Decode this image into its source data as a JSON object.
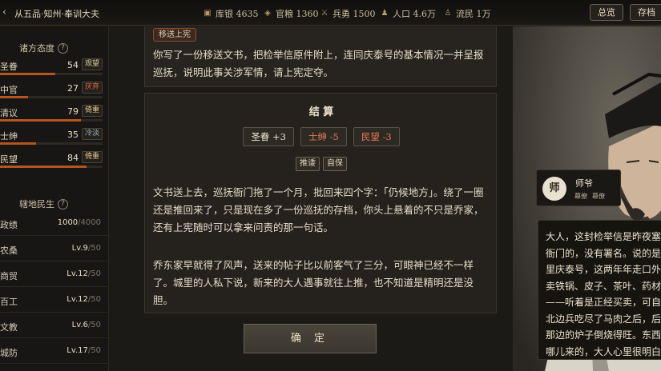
{
  "topbar": {
    "back": "‹",
    "title": "从五品·知州·奉训大夫",
    "resources": [
      {
        "icon": "silver-icon",
        "glyph": "▣",
        "label": "库银 4635"
      },
      {
        "icon": "grain-icon",
        "glyph": "◈",
        "label": "官粮 1360"
      },
      {
        "icon": "soldier-icon",
        "glyph": "⚔",
        "label": "兵勇 1500"
      },
      {
        "icon": "population-icon",
        "glyph": "♟",
        "label": "人口 4.6万"
      },
      {
        "icon": "refugee-icon",
        "glyph": "♙",
        "label": "流民 1万"
      }
    ],
    "overview_btn": "总览",
    "save_btn": "存档"
  },
  "sidebar": {
    "factions_title": "诸方态度",
    "factions": [
      {
        "name": "圣眷",
        "value": "54",
        "tag": "观望",
        "tag_color": "#d6c8a6",
        "level": 54,
        "bar_color": "#b5541f"
      },
      {
        "name": "中官",
        "value": "27",
        "tag": "厌弃",
        "tag_color": "#e0674a",
        "level": 27,
        "bar_color": "#b5541f"
      },
      {
        "name": "清议",
        "value": "79",
        "tag": "倚重",
        "tag_color": "#e6c98a",
        "level": 79,
        "bar_color": "#b5541f"
      },
      {
        "name": "士绅",
        "value": "35",
        "tag": "冷淡",
        "tag_color": "#9fb4c6",
        "level": 35,
        "bar_color": "#b5541f"
      },
      {
        "name": "民望",
        "value": "84",
        "tag": "倚重",
        "tag_color": "#e6c98a",
        "level": 84,
        "bar_color": "#b5541f"
      }
    ],
    "region_title": "辖地民生",
    "stats": [
      {
        "name": "政绩",
        "value": "1000",
        "max": "/4000"
      },
      {
        "name": "农桑",
        "value": "Lv.9",
        "max": "/50"
      },
      {
        "name": "商贸",
        "value": "Lv.12",
        "max": "/50"
      },
      {
        "name": "百工",
        "value": "Lv.12",
        "max": "/50"
      },
      {
        "name": "文教",
        "value": "Lv.6",
        "max": "/50"
      },
      {
        "name": "城防",
        "value": "Lv.17",
        "max": "/50"
      }
    ]
  },
  "prior_card": {
    "ribbon": "移送上宪",
    "text": "你写了一份移送文书，把检举信原件附上，连同庆泰号的基本情况一并呈报巡抚，说明此事关涉军情，请上宪定夺。"
  },
  "result_card": {
    "heading": "结 算",
    "effects": [
      {
        "label": "圣眷 +3",
        "color": "#f0e6d0"
      },
      {
        "label": "士绅 -5",
        "color": "#e4785a"
      },
      {
        "label": "民望 -3",
        "color": "#e4785a"
      }
    ],
    "tags": [
      "推诿",
      "自保"
    ],
    "para1": "文书送上去，巡抚衙门拖了一个月，批回来四个字：「仍候地方」。绕了一圈还是推回来了，只是现在多了一份巡抚的存档，你头上悬着的不只是乔家，还有上宪随时可以拿来问责的那一句话。",
    "para2": "乔东家早就得了风声，送来的帖子比以前客气了三分，可眼神已经不一样了。城里的人私下说，新来的大人遇事就往上推，也不知道是精明还是没胆。"
  },
  "confirm_label": "确 定",
  "speaker": {
    "seal": "师",
    "name": "师爷",
    "tags": [
      "幕僚",
      "幕僚"
    ]
  },
  "dialog_text": "大人，这封检举信是昨夜塞进衙门的，没有署名。说的是城里庆泰号，这两年年走口外，卖铁锅、皮子、茶叶、药材——听着是正经买卖，可自打北边兵吃尽了马肉之后，后金那边的炉子倒烧得旺。东西从哪儿来的，大人心里很明白。"
}
